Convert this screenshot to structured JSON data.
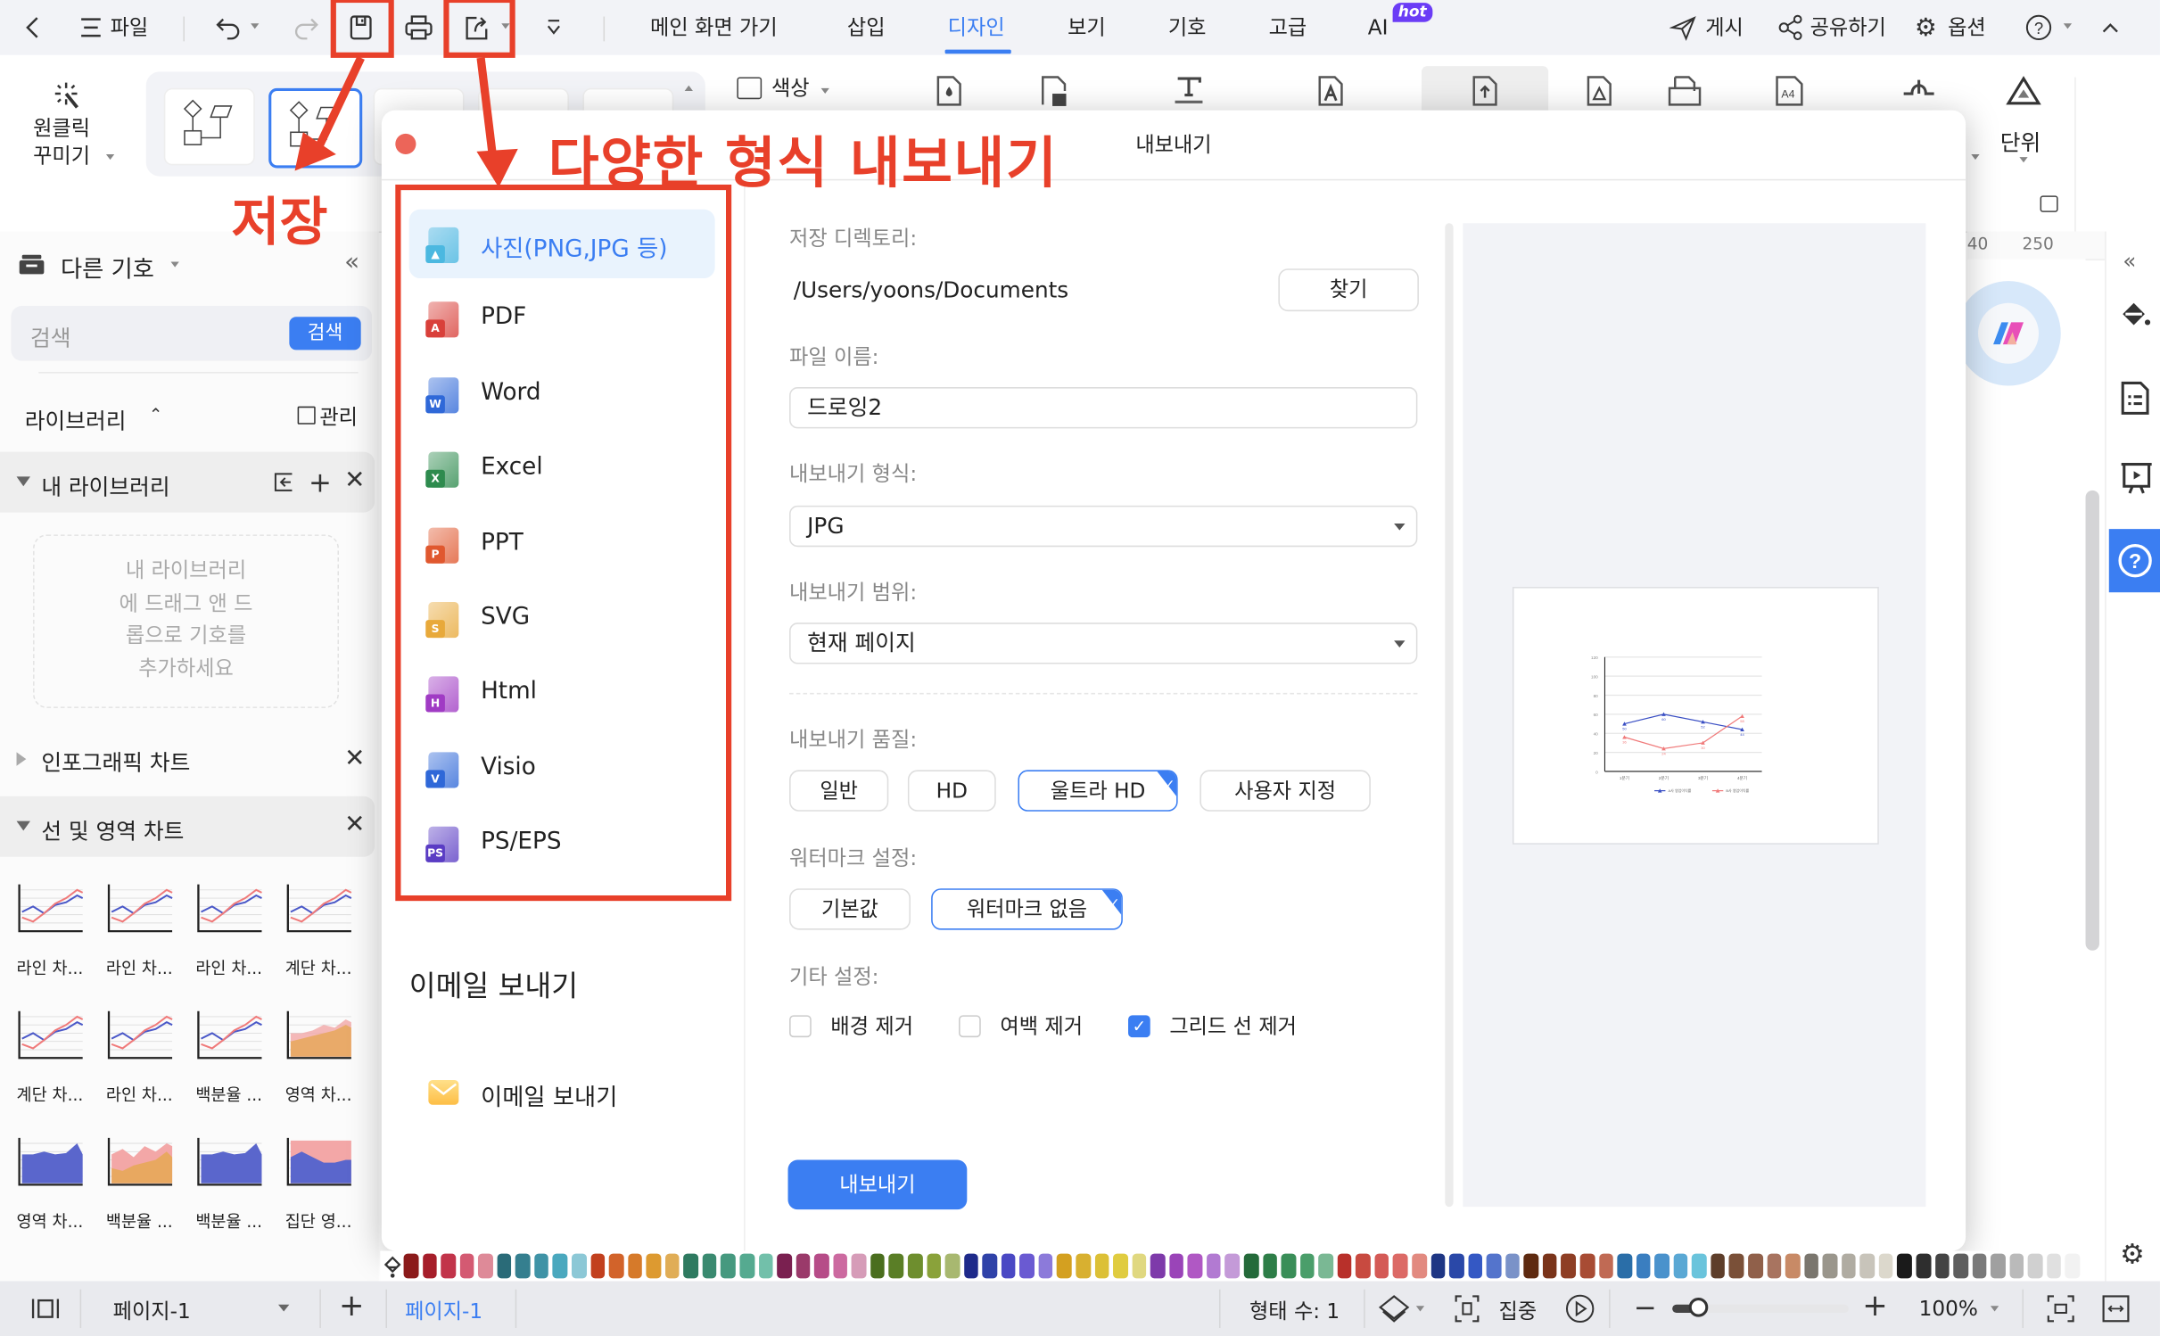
{
  "topbar": {
    "file_label": "파일",
    "tabs": [
      {
        "label": "메인 화면 가기",
        "active": false
      },
      {
        "label": "삽입",
        "active": false
      },
      {
        "label": "디자인",
        "active": true
      },
      {
        "label": "보기",
        "active": false
      },
      {
        "label": "기호",
        "active": false
      },
      {
        "label": "고급",
        "active": false
      },
      {
        "label": "AI",
        "active": false,
        "badge": "hot"
      }
    ],
    "publish_label": "게시",
    "share_label": "공유하기",
    "options_label": "옵션"
  },
  "ribbon": {
    "one_click_label_1": "원클릭",
    "one_click_label_2": "꾸미기",
    "color_label": "색상",
    "unit_label": "단위"
  },
  "ruler": {
    "ticks": [
      "40",
      "250"
    ]
  },
  "left_panel": {
    "title": "다른 기호",
    "search_placeholder": "검색",
    "search_button": "검색",
    "library_label": "라이브러리",
    "manage_label": "관리",
    "my_library_label": "내 라이브러리",
    "my_library_hint": [
      "내 라이브러리",
      "에 드래그 앤 드",
      "롭으로 기호를",
      "추가하세요"
    ],
    "infographic_label": "인포그래픽 차트",
    "line_area_label": "선 및 영역 차트",
    "chart_items": [
      "라인 차...",
      "라인 차...",
      "라인 차...",
      "계단 차...",
      "계단 차...",
      "라인 차...",
      "백분율 ...",
      "영역 차...",
      "영역 차...",
      "백분율 ...",
      "백분율 ...",
      "집단 영..."
    ]
  },
  "annotations": {
    "save_label": "저장",
    "export_label": "다양한 형식 내보내기",
    "color": "#e8402a"
  },
  "dialog": {
    "title": "내보내기",
    "formats": [
      {
        "label": "사진(PNG,JPG 등)",
        "icon": "image-file-icon",
        "color": "#4bb8e0",
        "badge": "",
        "active": true
      },
      {
        "label": "PDF",
        "icon": "pdf-file-icon",
        "color": "#d9403a",
        "badge": "A",
        "active": false
      },
      {
        "label": "Word",
        "icon": "word-file-icon",
        "color": "#2f68d8",
        "badge": "W",
        "active": false
      },
      {
        "label": "Excel",
        "icon": "excel-file-icon",
        "color": "#2e8b4e",
        "badge": "X",
        "active": false
      },
      {
        "label": "PPT",
        "icon": "ppt-file-icon",
        "color": "#e0582f",
        "badge": "P",
        "active": false
      },
      {
        "label": "SVG",
        "icon": "svg-file-icon",
        "color": "#e8a93a",
        "badge": "S",
        "active": false
      },
      {
        "label": "Html",
        "icon": "html-file-icon",
        "color": "#a03bc4",
        "badge": "H",
        "active": false
      },
      {
        "label": "Visio",
        "icon": "visio-file-icon",
        "color": "#2f68d8",
        "badge": "V",
        "active": false
      },
      {
        "label": "PS/EPS",
        "icon": "ps-file-icon",
        "color": "#5a3cc4",
        "badge": "PS",
        "active": false
      }
    ],
    "email_section_title": "이메일 보내기",
    "email_item_label": "이메일 보내기",
    "directory_label": "저장 디렉토리:",
    "directory_value": "/Users/yoons/Documents",
    "browse_button": "찾기",
    "filename_label": "파일 이름:",
    "filename_value": "드로잉2",
    "format_label": "내보내기 형식:",
    "format_value": "JPG",
    "range_label": "내보내기 범위:",
    "range_value": "현재 페이지",
    "quality_label": "내보내기 품질:",
    "quality_options": [
      {
        "label": "일반",
        "selected": false
      },
      {
        "label": "HD",
        "selected": false
      },
      {
        "label": "울트라 HD",
        "selected": true
      },
      {
        "label": "사용자 지정",
        "selected": false
      }
    ],
    "watermark_label": "워터마크 설정:",
    "watermark_options": [
      {
        "label": "기본값",
        "selected": false
      },
      {
        "label": "워터마크 없음",
        "selected": true
      }
    ],
    "other_label": "기타 설정:",
    "other_options": [
      {
        "label": "배경 제거",
        "checked": false
      },
      {
        "label": "여백 제거",
        "checked": false
      },
      {
        "label": "그리드 선 제거",
        "checked": true
      }
    ],
    "export_button": "내보내기"
  },
  "chart_data": {
    "type": "line",
    "categories": [
      "1분기",
      "2분기",
      "3분기",
      "4분기"
    ],
    "series": [
      {
        "name": "A사 영업이익률",
        "values": [
          50,
          60,
          52,
          44
        ],
        "color": "#3a4fc4"
      },
      {
        "name": "B사 영업이익률",
        "values": [
          36,
          24,
          30,
          58
        ],
        "color": "#f07a7a"
      }
    ],
    "ylim": [
      0,
      120
    ],
    "yticks": [
      0,
      20,
      40,
      60,
      80,
      100,
      120
    ],
    "grid": true,
    "legend": "bottom"
  },
  "statusbar": {
    "page_select": "페이지-1",
    "page_tab": "페이지-1",
    "shape_count": "형태 수: 1",
    "focus_label": "집중",
    "zoom_value": "100%",
    "zoom_fraction": 0.15
  },
  "palette": [
    "#8b1a1a",
    "#a61e2a",
    "#c2344a",
    "#d45a72",
    "#de8a98",
    "#2a6b78",
    "#357f8f",
    "#3f93a6",
    "#4aa8be",
    "#8cc8d6",
    "#c2401e",
    "#d2632a",
    "#d67a2a",
    "#dd9a30",
    "#e0ad56",
    "#2e7a60",
    "#3a8a70",
    "#46997f",
    "#55aa90",
    "#72c0aa",
    "#7a2050",
    "#9a3a6a",
    "#b64c88",
    "#cc6aa0",
    "#d69cb8",
    "#4a6e1e",
    "#5a7e26",
    "#6e8e2e",
    "#8aa23a",
    "#a8b870",
    "#1e2a8a",
    "#2f42a8",
    "#4a48c4",
    "#6a5ad2",
    "#8c7ada",
    "#d4a020",
    "#d8b030",
    "#dcc036",
    "#e0cc40",
    "#e0d880",
    "#7e3aaa",
    "#9a44b8",
    "#b058c4",
    "#b27ad2",
    "#c49ad8",
    "#246a3a",
    "#2e7e48",
    "#3a8e58",
    "#4a9e6a",
    "#7ab894",
    "#b8302a",
    "#c84a40",
    "#d45a56",
    "#dc6a66",
    "#e28a80",
    "#1e3684",
    "#2a48a8",
    "#3458c4",
    "#5474cc",
    "#7a92c8",
    "#5e2a10",
    "#7a341a",
    "#8e3e24",
    "#a84c34",
    "#c06a54",
    "#2a6ea8",
    "#3a7ec0",
    "#4a92cc",
    "#5aa8d4",
    "#6ac4dc",
    "#5e3e2a",
    "#7a5038",
    "#90604a",
    "#a87460",
    "#c88a66",
    "#7a766e",
    "#9a968c",
    "#b0aca2",
    "#c8c4ba",
    "#dcd8cc",
    "#1a1a1a",
    "#2e2e2e",
    "#444444",
    "#5e5e5e",
    "#7a7a7a",
    "#a0a0a0",
    "#bababa",
    "#d0d0d0",
    "#e0e0e0",
    "#f2f2f2"
  ]
}
